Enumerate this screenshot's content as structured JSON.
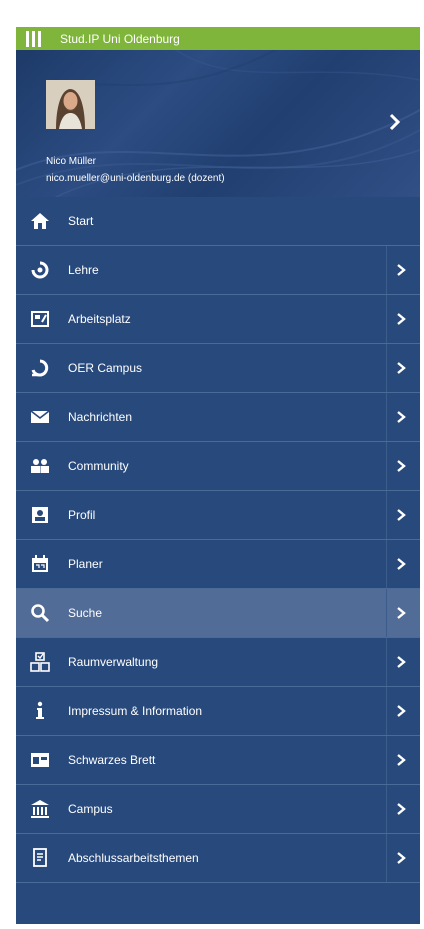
{
  "app": {
    "title": "Stud.IP Uni Oldenburg"
  },
  "user": {
    "name": "Nico Müller",
    "email": "nico.mueller@uni-oldenburg.de (dozent)"
  },
  "menu": {
    "items": [
      {
        "label": "Start",
        "icon": "home-icon"
      },
      {
        "label": "Lehre",
        "icon": "seminar-icon"
      },
      {
        "label": "Arbeitsplatz",
        "icon": "workplace-icon"
      },
      {
        "label": "OER Campus",
        "icon": "oer-icon"
      },
      {
        "label": "Nachrichten",
        "icon": "mail-icon"
      },
      {
        "label": "Community",
        "icon": "community-icon"
      },
      {
        "label": "Profil",
        "icon": "profile-icon"
      },
      {
        "label": "Planer",
        "icon": "calendar-icon"
      },
      {
        "label": "Suche",
        "icon": "search-icon"
      },
      {
        "label": "Raumverwaltung",
        "icon": "room-icon"
      },
      {
        "label": "Impressum & Information",
        "icon": "info-icon"
      },
      {
        "label": "Schwarzes Brett",
        "icon": "board-icon"
      },
      {
        "label": "Campus",
        "icon": "campus-icon"
      },
      {
        "label": "Abschlussarbeitsthemen",
        "icon": "thesis-icon"
      }
    ],
    "active": "Suche"
  },
  "colors": {
    "topbar": "#7fb53a",
    "panel": "#28497c",
    "active_row": "#516c97",
    "text": "#ffffff"
  }
}
